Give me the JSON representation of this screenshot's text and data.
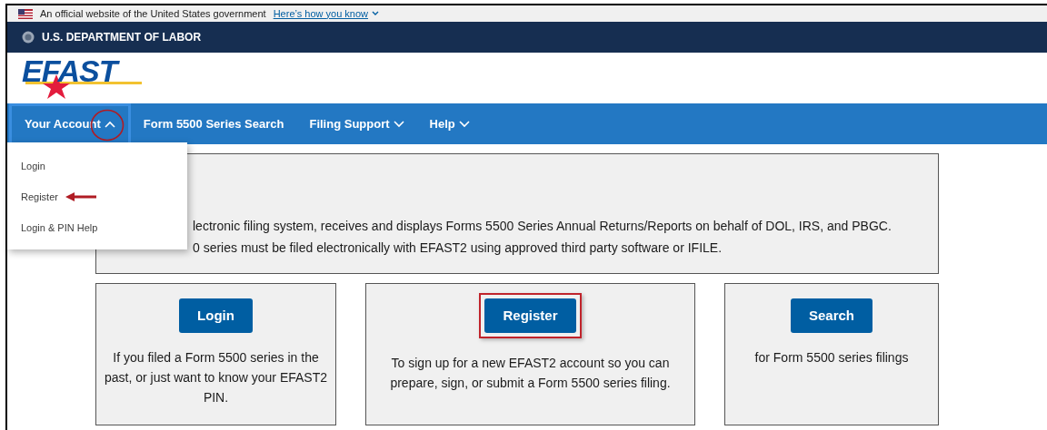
{
  "banner": {
    "text": "An official website of the United States government",
    "link": "Here’s how you know"
  },
  "agency": "U.S. DEPARTMENT OF LABOR",
  "logo": "EFAST",
  "nav": [
    {
      "label": "Your Account",
      "kind": "menu",
      "expanded": true,
      "annotated": true
    },
    {
      "label": "Form 5500 Series Search",
      "kind": "link"
    },
    {
      "label": "Filing Support",
      "kind": "menu",
      "expanded": false,
      "annotated": false
    },
    {
      "label": "Help",
      "kind": "menu",
      "expanded": false,
      "annotated": false
    }
  ],
  "dropdown": [
    {
      "label": "Login",
      "annotated": false
    },
    {
      "label": "Register",
      "annotated": true
    },
    {
      "label": "Login & PIN Help",
      "annotated": false
    }
  ],
  "intro": [
    "lectronic filing system, receives and displays Forms 5500 Series Annual Returns/Reports on behalf of DOL, IRS, and PBGC.",
    "0 series must be filed electronically with EFAST2 using approved third party software or IFILE."
  ],
  "cards": [
    {
      "button": "Login",
      "text": "If you filed a Form 5500 series in the past, or just want to know your EFAST2 PIN.",
      "highlighted": false
    },
    {
      "button": "Register",
      "text": "To sign up for a new EFAST2 account so you can prepare, sign, or submit a Form 5500 series filing.",
      "highlighted": true
    },
    {
      "button": "Search",
      "text": "for Form 5500 series filings",
      "highlighted": false
    }
  ]
}
